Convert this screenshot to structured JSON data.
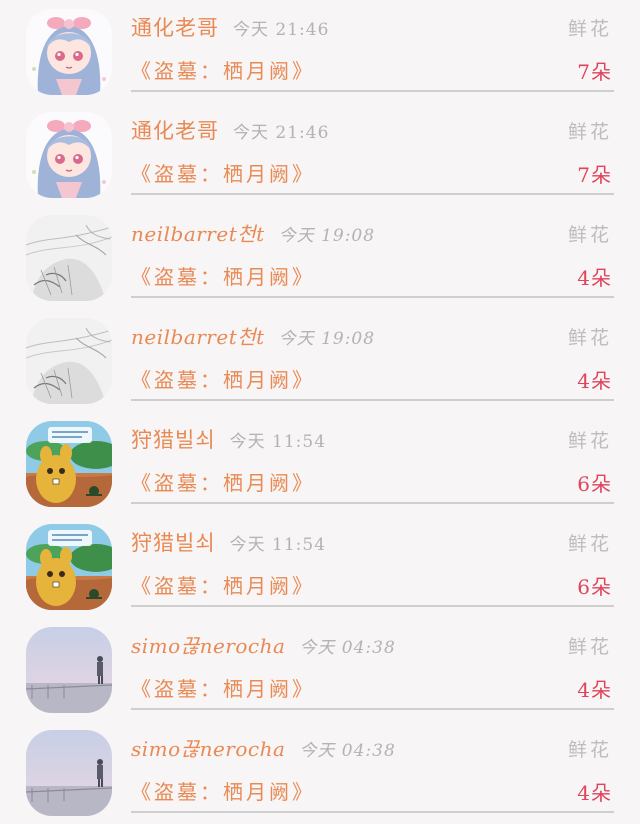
{
  "items": [
    {
      "name": "通化老哥",
      "time": "今天 21:46",
      "gift": "鲜花",
      "book": "《盗墓：栖月阙》",
      "count": "7朵",
      "avatar": "anime-girl"
    },
    {
      "name": "通化老哥",
      "time": "今天 21:46",
      "gift": "鲜花",
      "book": "《盗墓：栖月阙》",
      "count": "7朵",
      "avatar": "anime-girl"
    },
    {
      "name": "neilbarret천t",
      "time": "今天 19:08",
      "gift": "鲜花",
      "book": "《盗墓：栖月阙》",
      "count": "4朵",
      "avatar": "sketch"
    },
    {
      "name": "neilbarret천t",
      "time": "今天 19:08",
      "gift": "鲜花",
      "book": "《盗墓：栖月阙》",
      "count": "4朵",
      "avatar": "sketch"
    },
    {
      "name": "狩猎빌쇠",
      "time": "今天 11:54",
      "gift": "鲜花",
      "book": "《盗墓：栖月阙》",
      "count": "6朵",
      "avatar": "cartoon"
    },
    {
      "name": "狩猎빌쇠",
      "time": "今天 11:54",
      "gift": "鲜花",
      "book": "《盗墓：栖月阙》",
      "count": "6朵",
      "avatar": "cartoon"
    },
    {
      "name": "simo끊nerocha",
      "time": "今天 04:38",
      "gift": "鲜花",
      "book": "《盗墓：栖月阙》",
      "count": "4朵",
      "avatar": "seaside"
    },
    {
      "name": "simo끊nerocha",
      "time": "今天 04:38",
      "gift": "鲜花",
      "book": "《盗墓：栖月阙》",
      "count": "4朵",
      "avatar": "seaside"
    }
  ],
  "colors": {
    "accent": "#e98a55",
    "count": "#e0435a",
    "muted": "#b3b3b3",
    "divider": "#cfcfcf",
    "background": "#f7f5f5"
  }
}
